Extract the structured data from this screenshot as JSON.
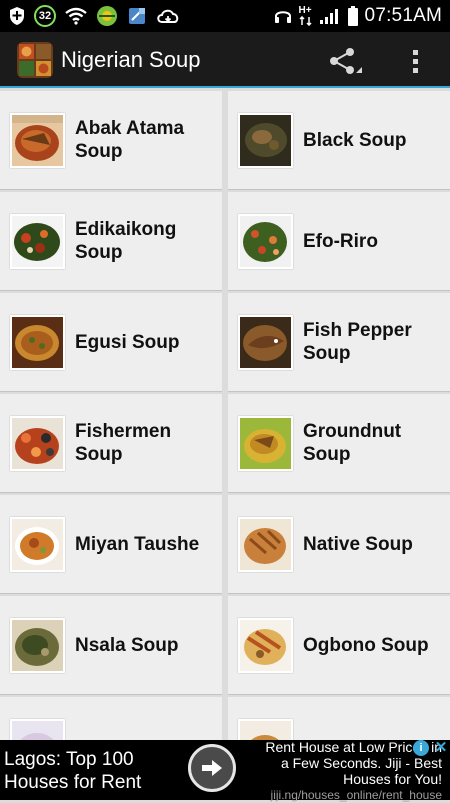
{
  "status_bar": {
    "notification_badge": "32",
    "network_label": "H+",
    "time": "07:51AM",
    "icons": [
      "shield-plus-icon",
      "badge-32-icon",
      "wifi-icon",
      "game-icon",
      "tablet-icon",
      "cloud-icon",
      "headset-icon",
      "signal-icon",
      "battery-icon"
    ]
  },
  "action_bar": {
    "title": "Nigerian Soup",
    "share_label": "Share",
    "more_label": "More options",
    "accent": "#38a7d6"
  },
  "soups": [
    {
      "name": "Abak Atama Soup",
      "thumb": "abak-atama-icon"
    },
    {
      "name": "Black Soup",
      "thumb": "black-soup-icon"
    },
    {
      "name": "Edikaikong Soup",
      "thumb": "edikaikong-icon"
    },
    {
      "name": "Efo-Riro",
      "thumb": "efo-riro-icon"
    },
    {
      "name": "Egusi Soup",
      "thumb": "egusi-icon"
    },
    {
      "name": "Fish Pepper Soup",
      "thumb": "fish-pepper-icon"
    },
    {
      "name": "Fishermen Soup",
      "thumb": "fishermen-icon"
    },
    {
      "name": "Groundnut Soup",
      "thumb": "groundnut-icon"
    },
    {
      "name": "Miyan Taushe",
      "thumb": "miyan-taushe-icon"
    },
    {
      "name": "Native Soup",
      "thumb": "native-soup-icon"
    },
    {
      "name": "Nsala Soup",
      "thumb": "nsala-icon"
    },
    {
      "name": "Ogbono Soup",
      "thumb": "ogbono-icon"
    },
    {
      "name": "",
      "thumb": "partial-icon"
    },
    {
      "name": "",
      "thumb": "partial-icon"
    }
  ],
  "ad": {
    "left_line1": "Lagos: Top 100",
    "left_line2": "Houses for Rent",
    "right_line1": "Rent House at Low Prices in",
    "right_line2": "a Few Seconds. Jiji - Best",
    "right_line3": "Houses for You!",
    "url": "jiji.ng/houses_online/rent_house",
    "info_glyph": "i",
    "close_glyph": "✕"
  }
}
